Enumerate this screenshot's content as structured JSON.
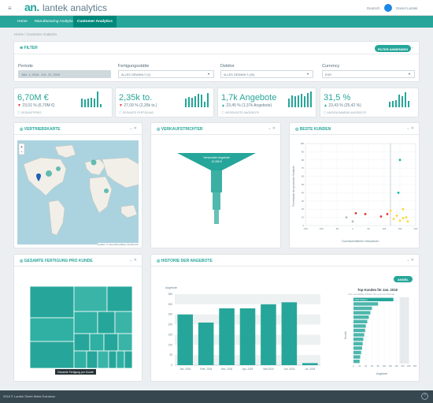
{
  "app": {
    "logo_mark": "an.",
    "logo_text": "lantek analytics",
    "language": "Deutsch",
    "user": "Daniel Lantek"
  },
  "nav": {
    "items": [
      "Home",
      "Manufacturing Analytics",
      "Customer Analytics"
    ],
    "active": "Customer Analytics"
  },
  "breadcrumb": "Home / Customer Analytics",
  "filter": {
    "title": "FILTER",
    "apply_label": "FILTER ANWENDEN",
    "fields": [
      {
        "label": "Periode",
        "value": "JAN. 1, 2018 - JUL. 31, 2018"
      },
      {
        "label": "Fertigungsstätte",
        "value": "ALLES GEWÄHLT (2)"
      },
      {
        "label": "Debitor",
        "value": "ALLES GEWÄHLT (40)"
      },
      {
        "label": "Currency",
        "value": "EUR"
      }
    ]
  },
  "kpis": [
    {
      "value": "6,70M €",
      "change": "23,01 % (6,70M €)",
      "direction": "down",
      "label": "GESAMTPREIS",
      "bars": [
        0.55,
        0.5,
        0.55,
        0.6,
        0.55,
        1.0,
        0.2
      ]
    },
    {
      "value": "2,35k to.",
      "change": "27,09 % (2,35k to.)",
      "direction": "down",
      "label": "GESAMTE FERTIGUNG",
      "bars": [
        0.55,
        0.65,
        0.6,
        0.7,
        0.85,
        0.8,
        0.35,
        0.9
      ]
    },
    {
      "value": "1,7k Angebote",
      "change": "23,45 % (1,37k Angebote)",
      "direction": "up",
      "label": "VIESENGETE ANGEBOTE",
      "bars": [
        0.55,
        0.75,
        0.7,
        0.75,
        0.85,
        0.7,
        0.9,
        1.0
      ]
    },
    {
      "value": "31,5 %",
      "change": "23,43 % (25,42 %)",
      "direction": "up",
      "label": "ANGENOMMENE ANGEBOTE",
      "bars": [
        0.35,
        0.4,
        0.45,
        0.8,
        0.7,
        0.95,
        0.4
      ]
    }
  ],
  "panels": {
    "map": {
      "title": "VERTRIEBSKARTE",
      "zoom_in": "+",
      "zoom_out": "−",
      "attribution": "Leaflet | © OpenStreetMap contributors"
    },
    "funnel": {
      "title": "VERKAUFSTRICHTER",
      "top_label": "Versendete Angebote",
      "top_value": "13.356 €"
    },
    "scatter": {
      "title": "BESTE KUNDEN",
      "xlabel": "Durchschnittlicher Verkaufsrei.",
      "ylabel": "Prozentsatz der gewonnen Verkäufe"
    },
    "treemap": {
      "title": "GESAMTE FERTIGUNG PRO KUNDE",
      "tooltip": "Gesamte Fertigung pro Kunde"
    },
    "history": {
      "title": "HISTORIE DER ANGEBOTE",
      "button": "ANGEL",
      "ylabel": "Angebote",
      "side_title": "Top Kunden für Jan. 2018",
      "side_subtitle": "Zum Auswählen klicken Sie auf eine Periode",
      "side_first": "Rath Glisson",
      "side_xlabel": "Angebote",
      "side_ylabel": "Kunde"
    }
  },
  "chart_data": [
    {
      "type": "bar",
      "title": "",
      "xlabel": "",
      "ylabel": "Angebote",
      "categories": [
        "Jan. 2018",
        "Febr. 2018",
        "Mrz. 2018",
        "Apr. 2018",
        "Mai 2018",
        "Jun. 2018",
        "Jul. 2018"
      ],
      "values": [
        250,
        210,
        280,
        280,
        300,
        310,
        10
      ],
      "ylim": [
        0,
        350
      ],
      "yticks": [
        0,
        50,
        100,
        150,
        200,
        250,
        300,
        350
      ]
    },
    {
      "type": "bar",
      "title": "Top Kunden für Jan. 2018",
      "xlabel": "Angebote",
      "ylabel": "Kunde",
      "values": [
        130,
        80,
        60,
        55,
        50,
        45,
        40,
        38,
        35,
        32,
        30,
        28,
        25,
        22,
        20
      ],
      "first_category": "Rath Glisson",
      "ylim": [
        0,
        200
      ]
    },
    {
      "type": "scatter",
      "title": "",
      "xlabel": "Durchschnittlicher Verkaufsrei.",
      "ylabel": "Prozentsatz der gewonnen Verkäufe",
      "xlim": [
        -150,
        200
      ],
      "ylim": [
        0,
        100
      ],
      "points": [
        {
          "x": 10,
          "y": 15,
          "c": "#e53935"
        },
        {
          "x": 40,
          "y": 14,
          "c": "#e53935"
        },
        {
          "x": 90,
          "y": 11,
          "c": "#e53935"
        },
        {
          "x": 110,
          "y": 14,
          "c": "#e53935"
        },
        {
          "x": 120,
          "y": 18,
          "c": "#fdd835"
        },
        {
          "x": 130,
          "y": 8,
          "c": "#fdd835"
        },
        {
          "x": 140,
          "y": 12,
          "c": "#fdd835"
        },
        {
          "x": 150,
          "y": 6,
          "c": "#fdd835"
        },
        {
          "x": 160,
          "y": 9,
          "c": "#fdd835"
        },
        {
          "x": 170,
          "y": 10,
          "c": "#fdd835"
        },
        {
          "x": 175,
          "y": 5,
          "c": "#fdd835"
        },
        {
          "x": 160,
          "y": 20,
          "c": "#fdd835"
        },
        {
          "x": 145,
          "y": 40,
          "c": "#00bfa5"
        },
        {
          "x": 150,
          "y": 80,
          "c": "#00bfa5"
        },
        {
          "x": 0,
          "y": 5,
          "c": "#b0bec5"
        },
        {
          "x": -20,
          "y": 10,
          "c": "#b0bec5"
        }
      ]
    }
  ],
  "footer": {
    "text": "2018 © Lantek Sheet Metal Solutions"
  }
}
